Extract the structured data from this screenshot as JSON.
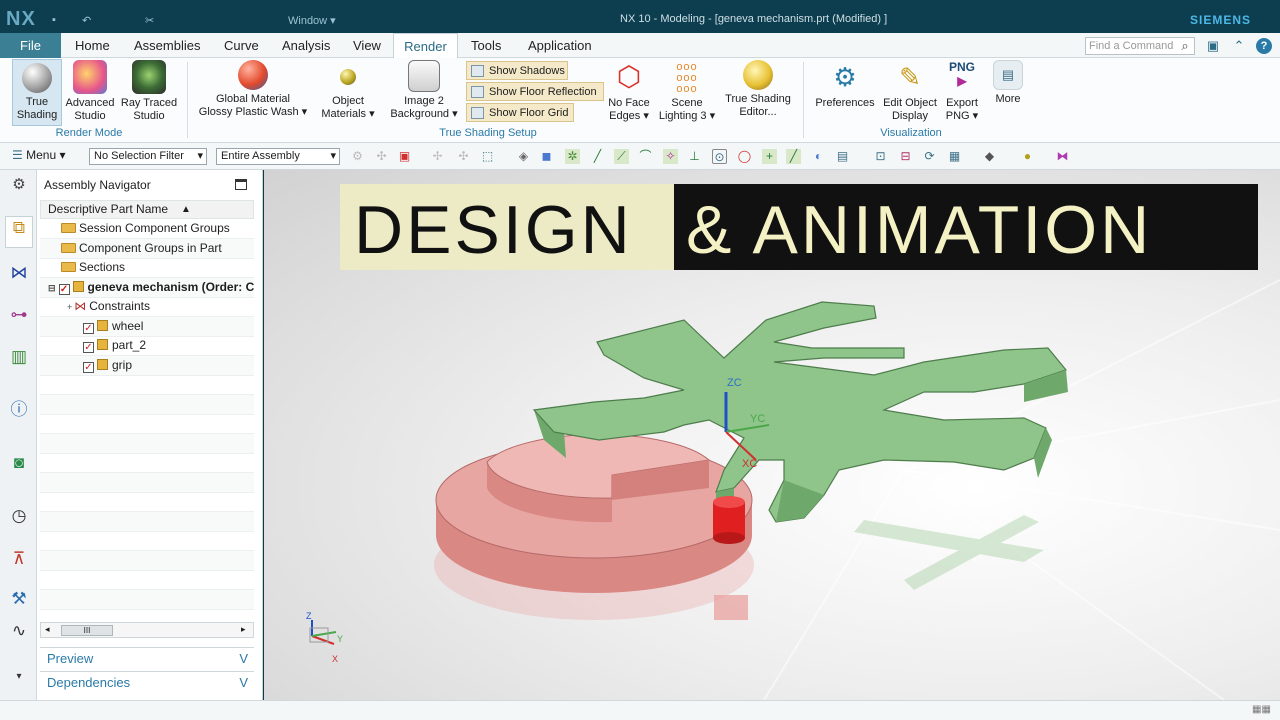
{
  "titlebar": {
    "logo": "NX",
    "window_menu": "Window ▾",
    "title": "NX 10 - Modeling - [geneva mechanism.prt (Modified) ]",
    "brand": "SIEMENS"
  },
  "menu": {
    "file": "File",
    "tabs": [
      "Home",
      "Assemblies",
      "Curve",
      "Analysis",
      "View",
      "Render",
      "Tools",
      "Application"
    ],
    "active_tab": "Render",
    "find_placeholder": "Find a Command"
  },
  "ribbon": {
    "true_shading": "True\nShading",
    "advanced_studio": "Advanced\nStudio",
    "ray_traced_studio": "Ray Traced\nStudio",
    "render_mode_group": "Render Mode",
    "global_material": "Global Material\nGlossy Plastic Wash ▾",
    "object_materials": "Object\nMaterials ▾",
    "image_background": "Image 2\nBackground ▾",
    "show_shadows": "Show Shadows",
    "show_floor_reflection": "Show Floor Reflection",
    "show_floor_grid": "Show Floor Grid",
    "no_face_edges": "No Face\nEdges ▾",
    "scene_lighting": "Scene\nLighting 3 ▾",
    "true_shading_editor": "True Shading\nEditor...",
    "true_shading_setup_group": "True Shading Setup",
    "preferences": "Preferences",
    "edit_object_display": "Edit Object\nDisplay",
    "export_png": "Export\nPNG ▾",
    "png_label": "PNG",
    "more": "More",
    "visualization_group": "Visualization"
  },
  "toolbar": {
    "menu": "Menu ▾",
    "selection_filter": "No Selection Filter",
    "assembly_scope": "Entire Assembly"
  },
  "navigator": {
    "title": "Assembly Navigator",
    "column": "Descriptive Part Name",
    "rows": [
      {
        "label": "Session Component Groups"
      },
      {
        "label": "Component Groups in Part"
      },
      {
        "label": "Sections"
      },
      {
        "label": "geneva mechanism (Order: C"
      },
      {
        "label": "Constraints"
      },
      {
        "label": "wheel"
      },
      {
        "label": "part_2"
      },
      {
        "label": "grip"
      }
    ],
    "scroll_thumb": "III",
    "preview": "Preview",
    "dependencies": "Dependencies"
  },
  "graphics": {
    "banner_left": "DESIGN",
    "banner_right": "& ANIMATION",
    "axis_zc": "ZC",
    "axis_yc": "YC",
    "axis_xc": "XC",
    "tri_z": "Z",
    "tri_y": "Y",
    "tri_x": "X"
  },
  "colors": {
    "green_part": "#8fc48a",
    "pink_part": "#e8a6a3",
    "red_pin": "#e02020",
    "accent": "#2a7aa8"
  }
}
